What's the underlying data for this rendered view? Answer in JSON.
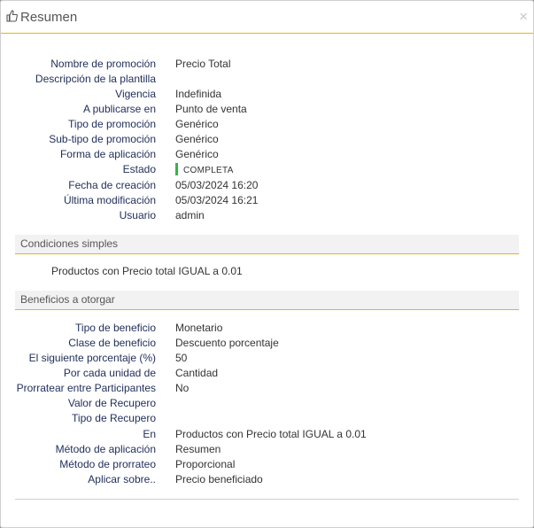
{
  "dialog": {
    "title": "Resumen",
    "close_label": "×"
  },
  "summary": [
    {
      "label": "Nombre de promoción",
      "value": "Precio Total"
    },
    {
      "label": "Descripción de la plantilla",
      "value": ""
    },
    {
      "label": "Vigencia",
      "value": "Indefinida"
    },
    {
      "label": "A publicarse en",
      "value": "Punto de venta"
    },
    {
      "label": "Tipo de promoción",
      "value": "Genérico"
    },
    {
      "label": "Sub-tipo de promoción",
      "value": "Genérico"
    },
    {
      "label": "Forma de aplicación",
      "value": "Genérico"
    },
    {
      "label": "Estado",
      "value": "COMPLETA"
    },
    {
      "label": "Fecha de creación",
      "value": "05/03/2024 16:20"
    },
    {
      "label": "Última modificación",
      "value": "05/03/2024 16:21"
    },
    {
      "label": "Usuario",
      "value": "admin"
    }
  ],
  "conditions": {
    "heading": "Condiciones simples",
    "text": "Productos con Precio total IGUAL a 0.01"
  },
  "benefits": {
    "heading": "Beneficios a otorgar",
    "rows": [
      {
        "label": "Tipo de beneficio",
        "value": "Monetario"
      },
      {
        "label": "Clase de beneficio",
        "value": "Descuento porcentaje"
      },
      {
        "label": "El siguiente porcentaje (%)",
        "value": "50"
      },
      {
        "label": "Por cada unidad de",
        "value": "Cantidad"
      },
      {
        "label": "Prorratear entre Participantes",
        "value": "No"
      },
      {
        "label": "Valor de Recupero",
        "value": ""
      },
      {
        "label": "Tipo de Recupero",
        "value": ""
      },
      {
        "label": "En",
        "value": "Productos con Precio total IGUAL a 0.01"
      },
      {
        "label": "Método de aplicación",
        "value": "Resumen"
      },
      {
        "label": "Método de prorrateo",
        "value": "Proporcional"
      },
      {
        "label": "Aplicar sobre..",
        "value": "Precio beneficiado"
      }
    ]
  },
  "colors": {
    "accent": "#e6b800",
    "status": "#38b24a"
  }
}
